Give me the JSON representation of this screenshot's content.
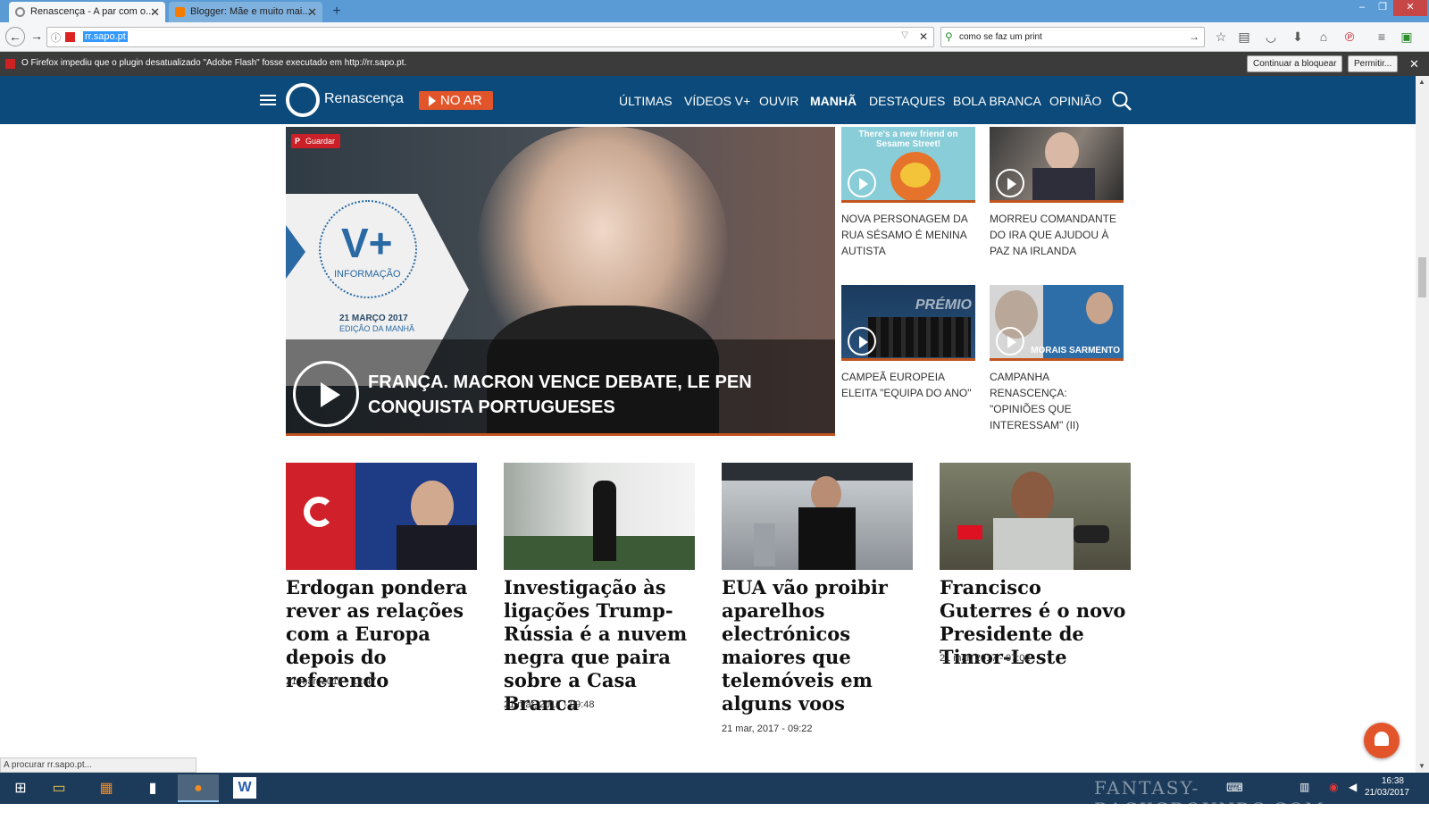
{
  "browser": {
    "tabs": [
      {
        "title": "Renascença - A par com o...",
        "active": true
      },
      {
        "title": "Blogger: Mãe e muito mai...",
        "active": false
      }
    ],
    "new_tab_symbol": "+",
    "url": "rr.sapo.pt",
    "search_query": "como se faz um print",
    "notification": {
      "text": "O Firefox impediu que o plugin desatualizado \"Adobe Flash\" fosse executado em http://rr.sapo.pt.",
      "block_label": "Continuar a bloquear",
      "allow_label": "Permitir..."
    },
    "status_text": "A procurar rr.sapo.pt..."
  },
  "site": {
    "logo_text": "Renascença",
    "live_label": "NO AR",
    "nav": [
      "ÚLTIMAS",
      "VÍDEOS V+",
      "OUVIR",
      "MANHÃ",
      "DESTAQUES",
      "BOLA BRANCA",
      "OPINIÃO"
    ],
    "active_nav": "MANHÃ"
  },
  "hero": {
    "pin_label": "Guardar",
    "badge": "V+",
    "badge_sub": "INFORMAÇÃO",
    "date": "21 MARÇO 2017",
    "edition": "EDIÇÃO DA MANHÃ",
    "title": "FRANÇA. MACRON VENCE DEBATE, LE PEN CONQUISTA PORTUGUESES"
  },
  "side_stories": [
    {
      "title": "NOVA PERSONAGEM DA RUA SÉSAMO É MENINA AUTISTA",
      "image_text": "There's a new friend on Sesame Street!"
    },
    {
      "title": "MORREU COMANDANTE DO IRA QUE AJUDOU À PAZ NA IRLANDA",
      "image_text": ""
    },
    {
      "title": "CAMPEÃ EUROPEIA ELEITA \"EQUIPA DO ANO\"",
      "image_text": "PRÉMIO"
    },
    {
      "title": "CAMPANHA RENASCENÇA: \"OPINIÕES QUE INTERESSAM\" (II)",
      "image_text": "MORAIS SARMENTO"
    }
  ],
  "articles": [
    {
      "title": "Erdogan pondera rever as relações com a Europa depois do referendo",
      "date": "21 mar, 2017 - 12:47"
    },
    {
      "title": "Investigação às ligações Trump-Rússia é a nuvem negra que paira sobre a Casa Branca",
      "date": "21 mar, 2017 - 09:48"
    },
    {
      "title": "EUA vão proibir aparelhos electrónicos maiores que telemóveis em alguns voos",
      "date": "21 mar, 2017 - 09:22"
    },
    {
      "title": "Francisco Guterres é o novo Presidente de Timor-Leste",
      "date": "21 mar, 2017 - 07:02"
    }
  ],
  "taskbar": {
    "time": "16:38",
    "date": "21/03/2017",
    "watermark": "FANTASY-BACKGROUNDS.COM"
  },
  "colors": {
    "site_header": "#0b4a7a",
    "accent_orange": "#e2552b",
    "tab_bar": "#5b9bd5"
  }
}
